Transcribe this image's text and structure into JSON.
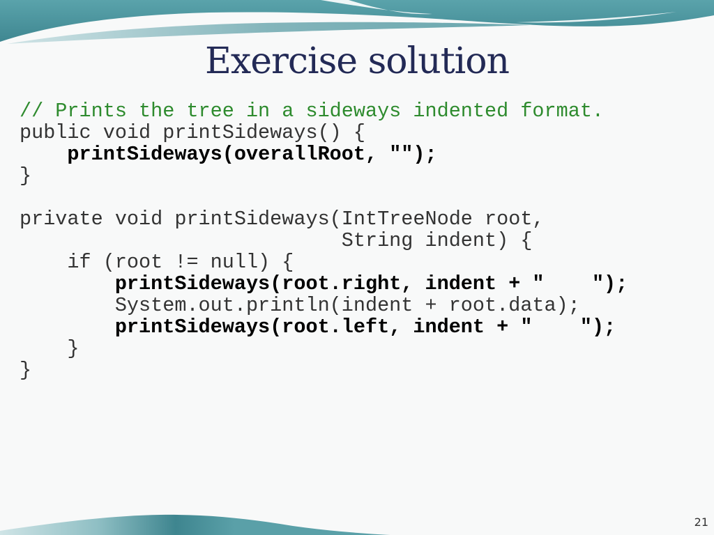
{
  "slide": {
    "title": "Exercise solution",
    "page_number": "21",
    "colors": {
      "title": "#232a56",
      "comment": "#2e8b2e",
      "accent": "#4f97a0"
    }
  },
  "code": {
    "lines": [
      {
        "segments": [
          {
            "text": "// Prints the tree in a sideways indented format.",
            "style": "comment"
          }
        ]
      },
      {
        "segments": [
          {
            "text": "public void printSideways() {",
            "style": "normal"
          }
        ]
      },
      {
        "segments": [
          {
            "text": "    ",
            "style": "normal"
          },
          {
            "text": "printSideways(overallRoot, \"\");",
            "style": "bold"
          }
        ]
      },
      {
        "segments": [
          {
            "text": "}",
            "style": "normal"
          }
        ]
      },
      {
        "segments": [
          {
            "text": "",
            "style": "normal"
          }
        ]
      },
      {
        "segments": [
          {
            "text": "private void printSideways(IntTreeNode root,",
            "style": "normal"
          }
        ]
      },
      {
        "segments": [
          {
            "text": "                           String indent) {",
            "style": "normal"
          }
        ]
      },
      {
        "segments": [
          {
            "text": "    if (root != null) {",
            "style": "normal"
          }
        ]
      },
      {
        "segments": [
          {
            "text": "        ",
            "style": "normal"
          },
          {
            "text": "printSideways(root.right, indent + \"    \");",
            "style": "bold"
          }
        ]
      },
      {
        "segments": [
          {
            "text": "        System.out.println(indent + root.data);",
            "style": "normal"
          }
        ]
      },
      {
        "segments": [
          {
            "text": "        ",
            "style": "normal"
          },
          {
            "text": "printSideways(root.left, indent + \"    \");",
            "style": "bold"
          }
        ]
      },
      {
        "segments": [
          {
            "text": "    }",
            "style": "normal"
          }
        ]
      },
      {
        "segments": [
          {
            "text": "}",
            "style": "normal"
          }
        ]
      }
    ]
  }
}
